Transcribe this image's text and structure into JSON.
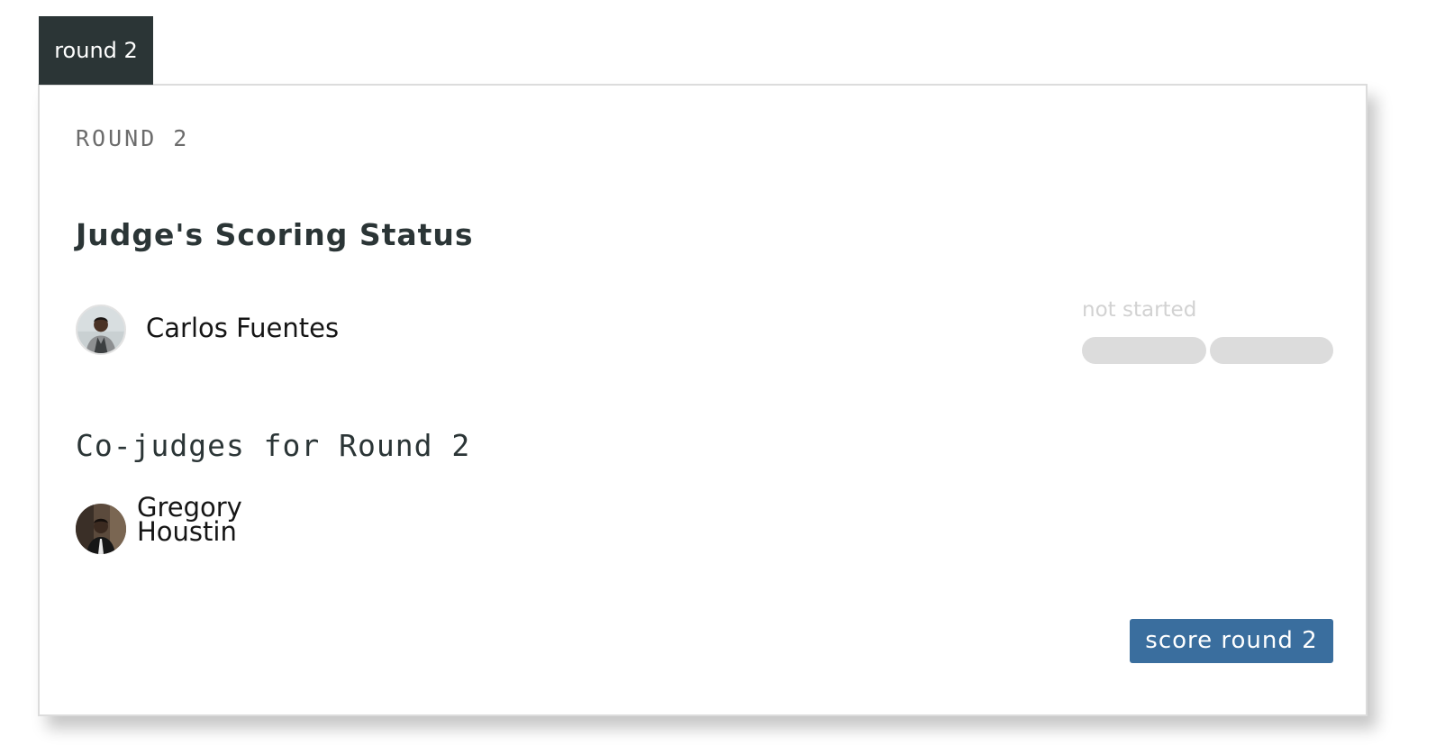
{
  "tab": {
    "label": "round 2"
  },
  "card": {
    "round_label": "ROUND 2",
    "status_title": "Judge's Scoring Status",
    "judge": {
      "name": "Carlos Fuentes",
      "status": "not started",
      "progress_segments": [
        {
          "filled_fraction": 0
        },
        {
          "filled_fraction": 0
        }
      ]
    },
    "cojudges_title": "Co-judges for Round 2",
    "cojudges": [
      {
        "name": "Gregory Houstin"
      }
    ],
    "score_button_label": "score round 2"
  },
  "colors": {
    "tab_bg": "#2b3536",
    "button_bg": "#3a6e9e",
    "progress_track": "#dcdcdc",
    "status_text": "#d2d2d2"
  }
}
